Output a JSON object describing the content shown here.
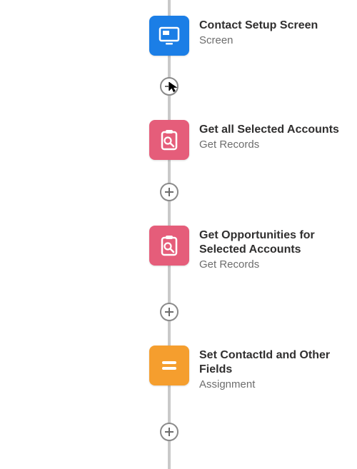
{
  "flow": {
    "nodes": [
      {
        "title": "Contact Setup Screen",
        "type_label": "Screen",
        "icon_name": "screen-icon",
        "color": "#1b7ee6"
      },
      {
        "title": "Get all Selected Accounts",
        "type_label": "Get Records",
        "icon_name": "clipboard-search-icon",
        "color": "#e55d7a"
      },
      {
        "title": "Get Opportunities for Selected Accounts",
        "type_label": "Get Records",
        "icon_name": "clipboard-search-icon",
        "color": "#e55d7a"
      },
      {
        "title": "Set ContactId and Other Fields",
        "type_label": "Assignment",
        "icon_name": "equals-icon",
        "color": "#f59e2e"
      }
    ],
    "connector_label": "Add Element"
  }
}
